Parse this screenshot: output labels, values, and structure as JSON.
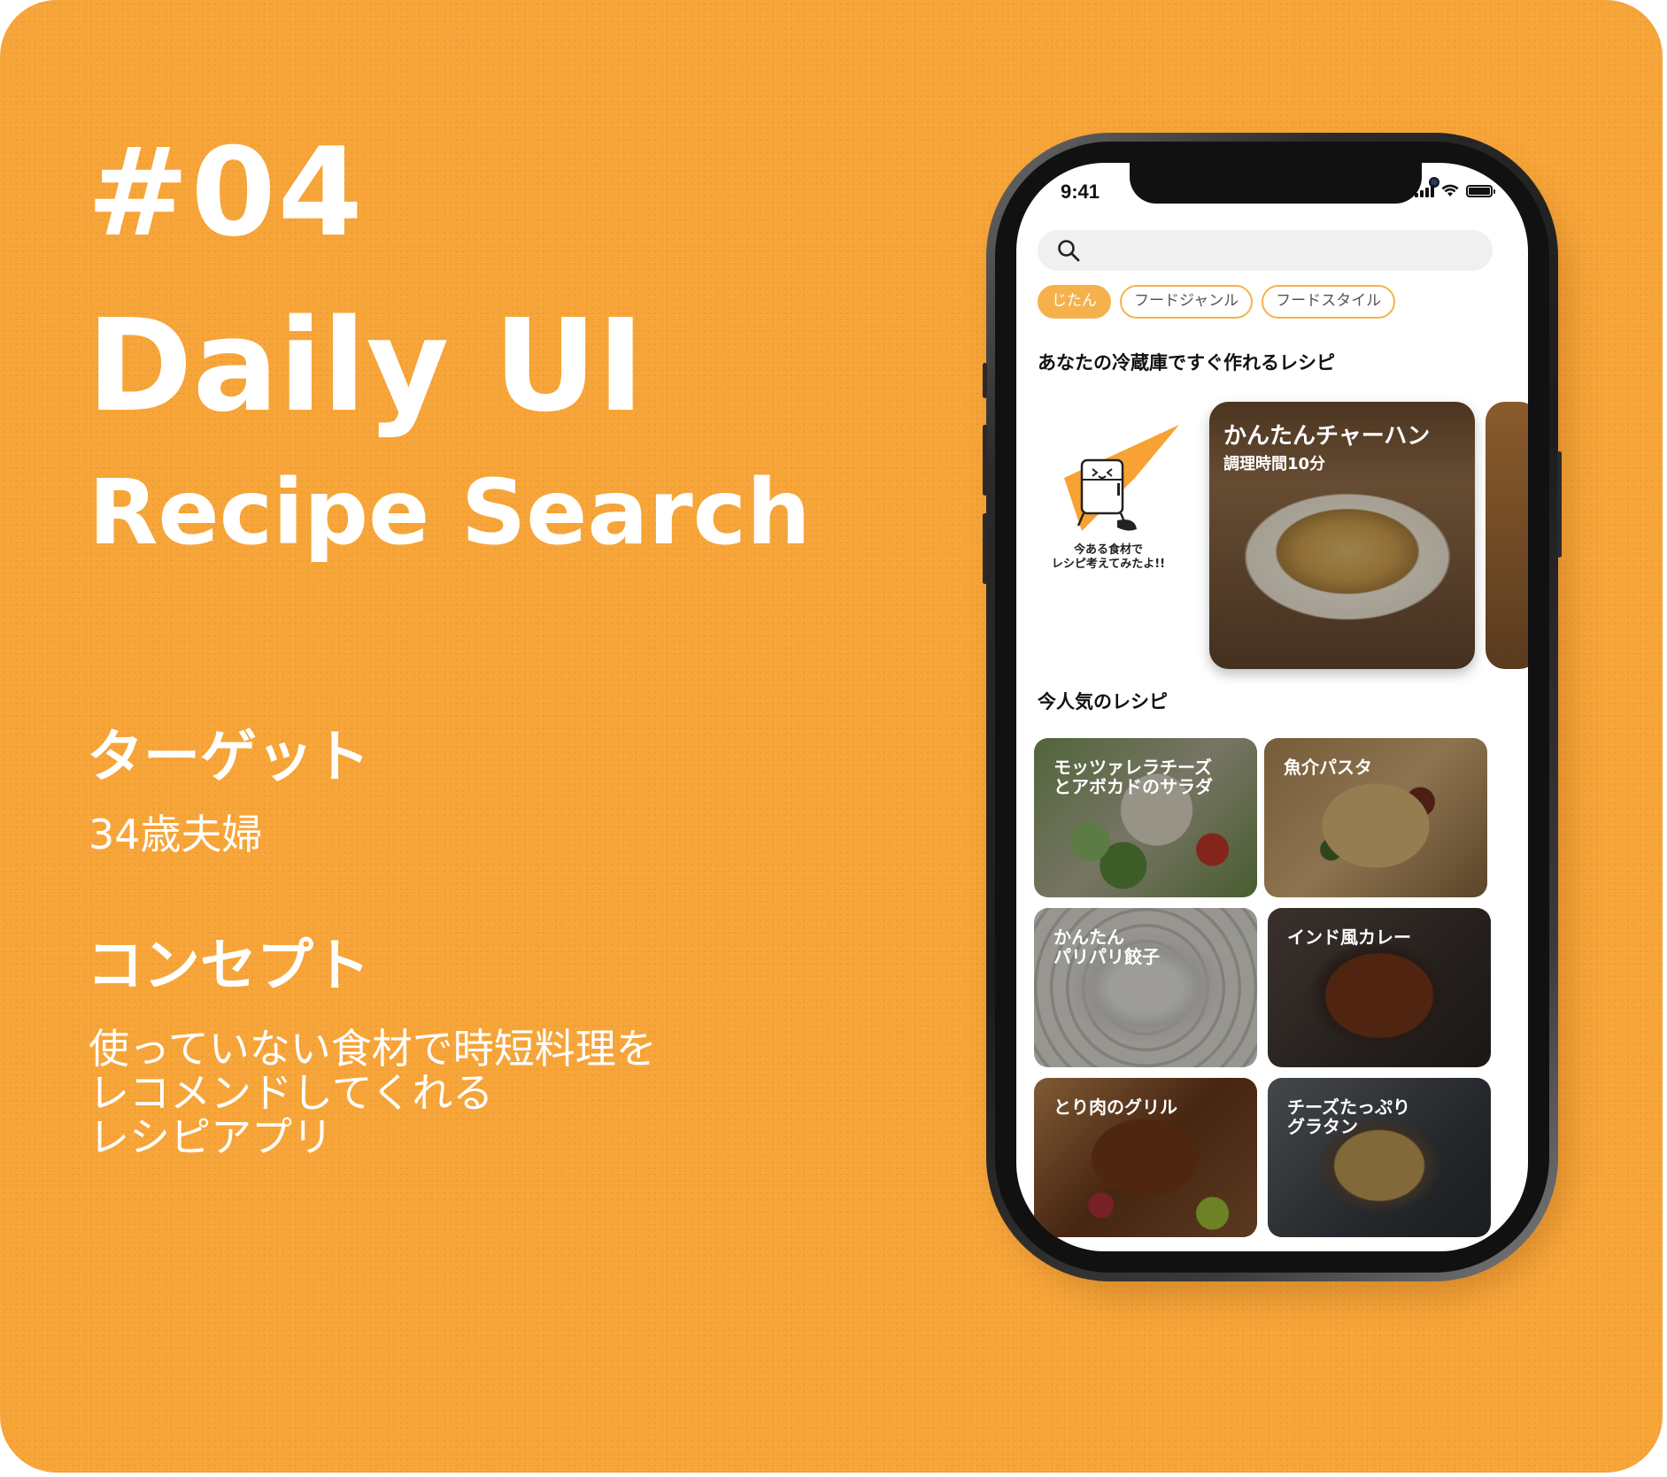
{
  "hero": {
    "number": "#04",
    "title": "Daily UI",
    "subtitle": "Recipe Search"
  },
  "target": {
    "heading": "ターゲット",
    "body": "34歳夫婦"
  },
  "concept": {
    "heading": "コンセプト",
    "body": "使っていない食材で時短料理を\nレコメンドしてくれる\nレシピアプリ"
  },
  "colors": {
    "background": "#f7a233",
    "accent": "#f5b24c"
  },
  "app": {
    "status_time": "9:41",
    "search": {
      "placeholder": "",
      "icon": "search-icon"
    },
    "chips": [
      {
        "label": "じたん",
        "active": true
      },
      {
        "label": "フードジャンル",
        "active": false
      },
      {
        "label": "フードスタイル",
        "active": false
      }
    ],
    "fridge_section": {
      "title": "あなたの冷蔵庫ですぐ作れるレシピ",
      "mascot_caption": "今ある食材で\nレシピ考えてみたよ!!",
      "featured": {
        "title": "かんたんチャーハン",
        "subtitle": "調理時間10分"
      }
    },
    "popular_section": {
      "title": "今人気のレシピ",
      "recipes": [
        {
          "title": "モッツァレラチーズ\nとアボカドのサラダ"
        },
        {
          "title": "魚介パスタ"
        },
        {
          "title": "かんたん\nパリパリ餃子"
        },
        {
          "title": "インド風カレー"
        },
        {
          "title": "とり肉のグリル"
        },
        {
          "title": "チーズたっぷり\nグラタン"
        }
      ]
    }
  }
}
